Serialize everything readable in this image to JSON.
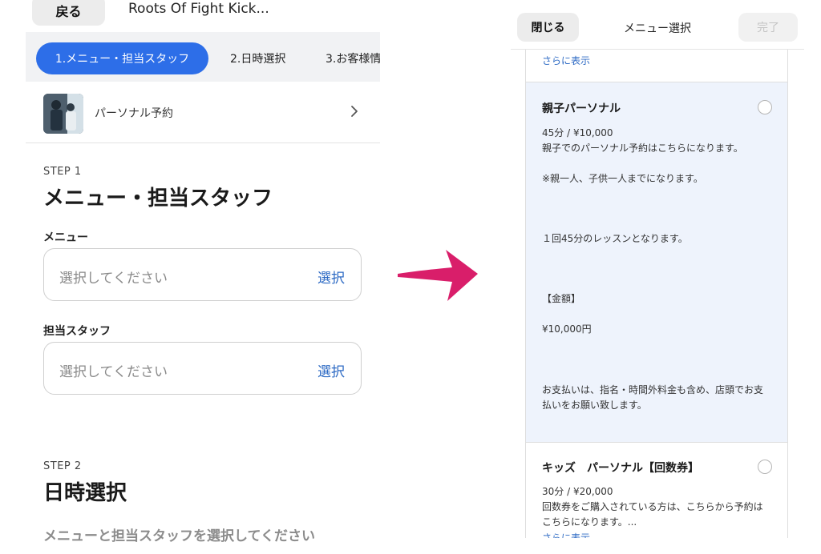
{
  "left": {
    "back_label": "戻る",
    "shop_title": "Roots Of Fight Kick...",
    "steps": [
      {
        "label": "1.メニュー・担当スタッフ"
      },
      {
        "label": "2.日時選択"
      },
      {
        "label": "3.お客様情"
      }
    ],
    "plan_label": "パーソナル予約",
    "step1": {
      "num": "STEP 1",
      "heading": "メニュー・担当スタッフ",
      "menu_label": "メニュー",
      "menu_placeholder": "選択してください",
      "menu_action": "選択",
      "staff_label": "担当スタッフ",
      "staff_placeholder": "選択してください",
      "staff_action": "選択"
    },
    "step2": {
      "num": "STEP 2",
      "heading": "日時選択",
      "hint": "メニューと担当スタッフを選択してください"
    }
  },
  "right": {
    "close_label": "閉じる",
    "title": "メニュー選択",
    "done_label": "完了",
    "top_more": "さらに表示",
    "cards": [
      {
        "name": "親子パーソナル",
        "price": "45分 / ¥10,000",
        "lines": [
          "親子でのパーソナル予約はこちらになります。",
          "※親一人、子供一人までになります。",
          "１回45分のレッスンとなります。",
          "【金額】",
          "¥10,000円",
          "お支払いは、指名・時間外料金も含め、店頭でお支",
          "払いをお願い致します。"
        ]
      },
      {
        "name": "キッズ　パーソナル【回数券】",
        "price": "30分 / ¥20,000",
        "lines": [
          "回数券をご購入されている方は、こちらから予約は",
          "こちらになります。..."
        ],
        "more": "さらに表示"
      }
    ]
  }
}
